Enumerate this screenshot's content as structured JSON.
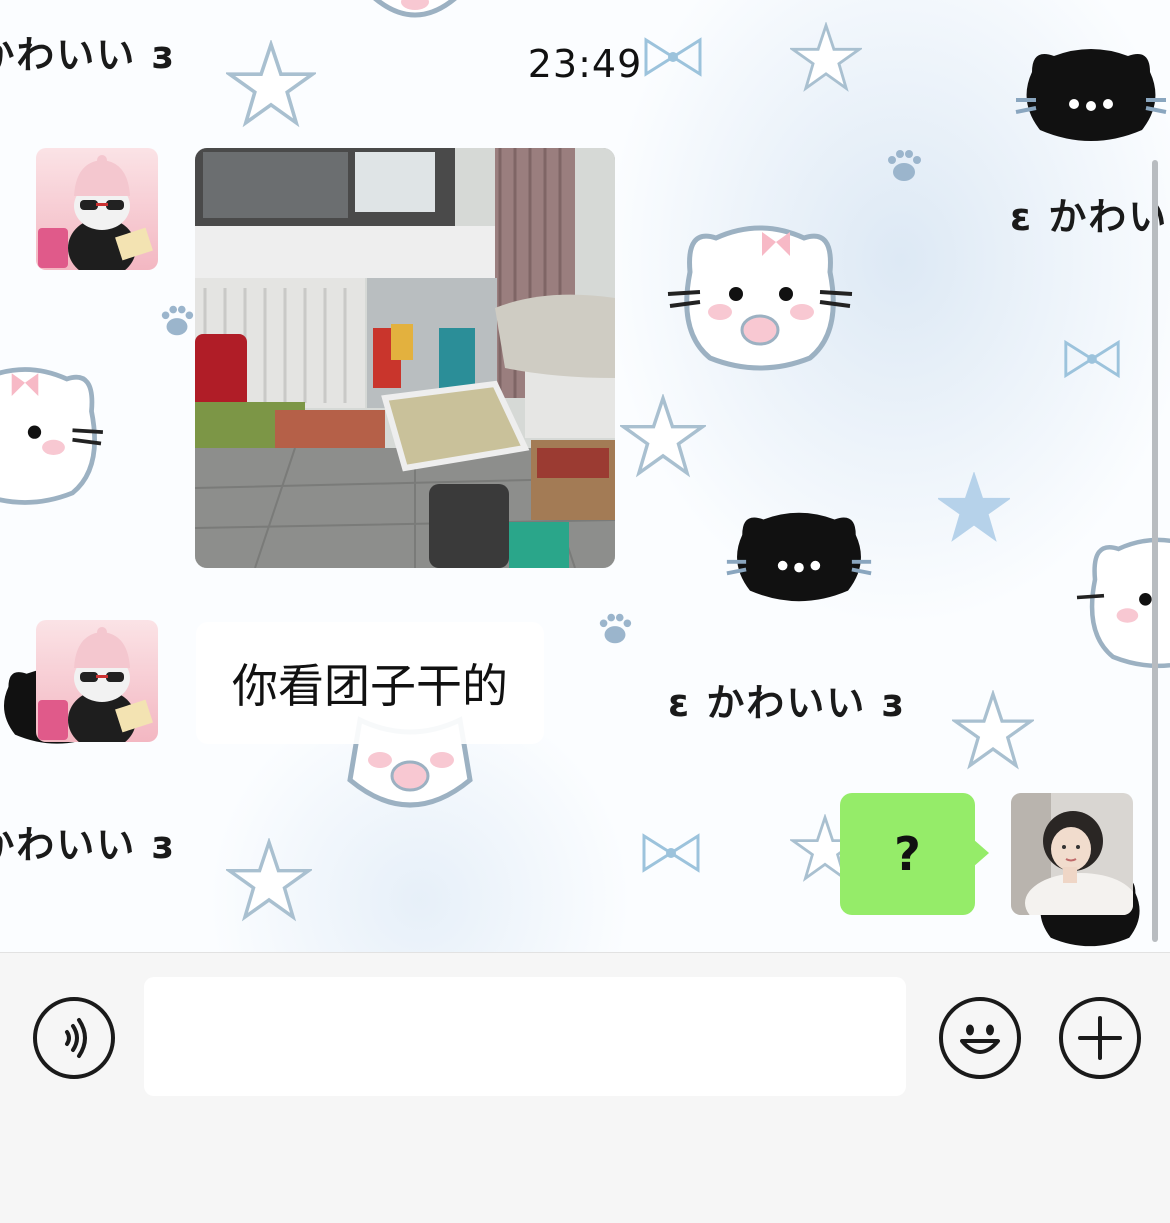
{
  "chat": {
    "timestamp": "23:49",
    "wallpaper_text": "ɛ かわいい з",
    "messages": [
      {
        "sender": "contact",
        "type": "image"
      },
      {
        "sender": "contact",
        "type": "text",
        "text": "你看团子干的"
      },
      {
        "sender": "self",
        "type": "text",
        "text": "?"
      }
    ],
    "self_bubble_color": "#95ec69"
  },
  "input_bar": {
    "voice_icon": "voice-icon",
    "emoji_icon": "emoji-icon",
    "more_icon": "plus-icon",
    "text_value": ""
  }
}
